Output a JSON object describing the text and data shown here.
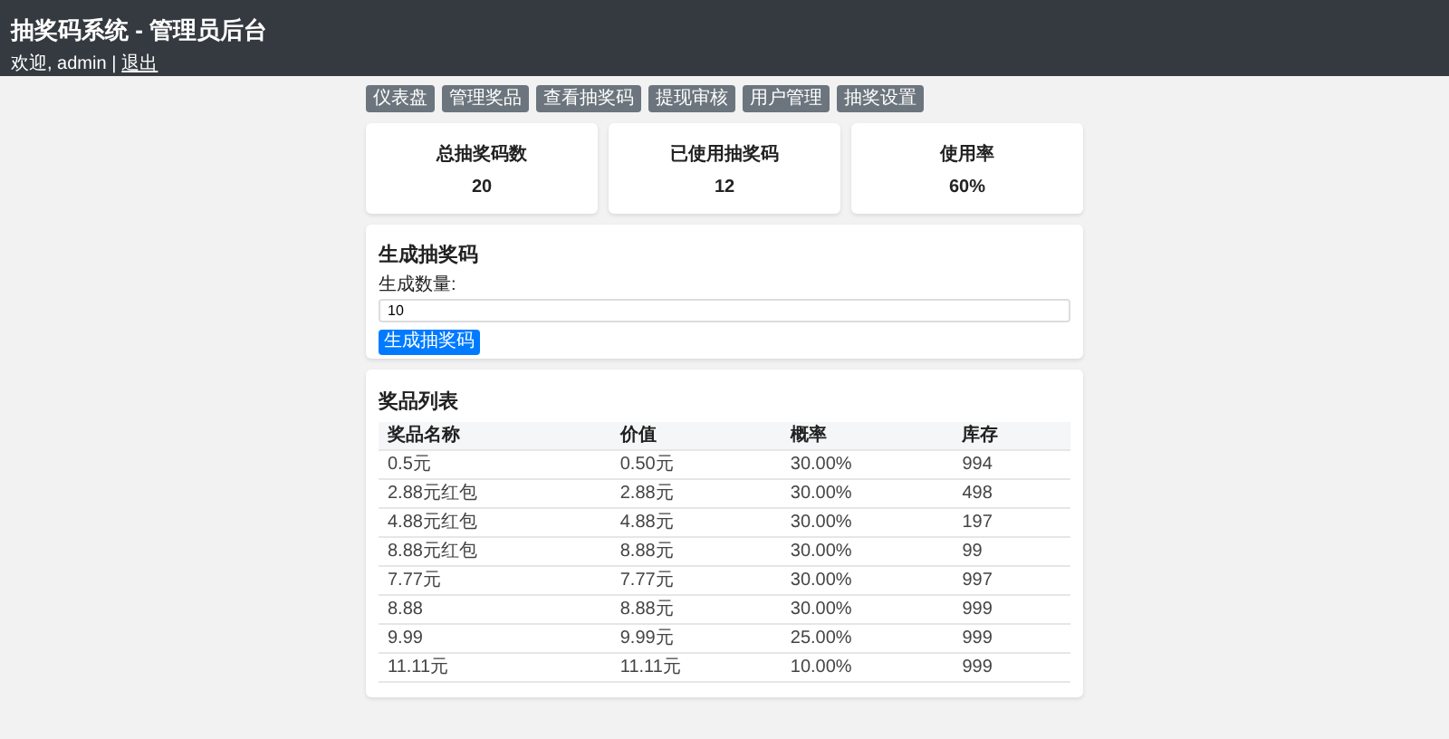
{
  "header": {
    "title": "抽奖码系统 - 管理员后台",
    "welcome": "欢迎, admin |",
    "logout": "退出"
  },
  "nav": [
    "仪表盘",
    "管理奖品",
    "查看抽奖码",
    "提现审核",
    "用户管理",
    "抽奖设置"
  ],
  "stats": [
    {
      "label": "总抽奖码数",
      "value": "20"
    },
    {
      "label": "已使用抽奖码",
      "value": "12"
    },
    {
      "label": "使用率",
      "value": "60%"
    }
  ],
  "generate": {
    "title": "生成抽奖码",
    "label": "生成数量:",
    "value": "10",
    "button": "生成抽奖码"
  },
  "prizes": {
    "title": "奖品列表",
    "columns": [
      "奖品名称",
      "价值",
      "概率",
      "库存"
    ],
    "rows": [
      [
        "0.5元",
        "0.50元",
        "30.00%",
        "994"
      ],
      [
        "2.88元红包",
        "2.88元",
        "30.00%",
        "498"
      ],
      [
        "4.88元红包",
        "4.88元",
        "30.00%",
        "197"
      ],
      [
        "8.88元红包",
        "8.88元",
        "30.00%",
        "99"
      ],
      [
        "7.77元",
        "7.77元",
        "30.00%",
        "997"
      ],
      [
        "8.88",
        "8.88元",
        "30.00%",
        "999"
      ],
      [
        "9.99",
        "9.99元",
        "25.00%",
        "999"
      ],
      [
        "11.11元",
        "11.11元",
        "10.00%",
        "999"
      ]
    ]
  }
}
